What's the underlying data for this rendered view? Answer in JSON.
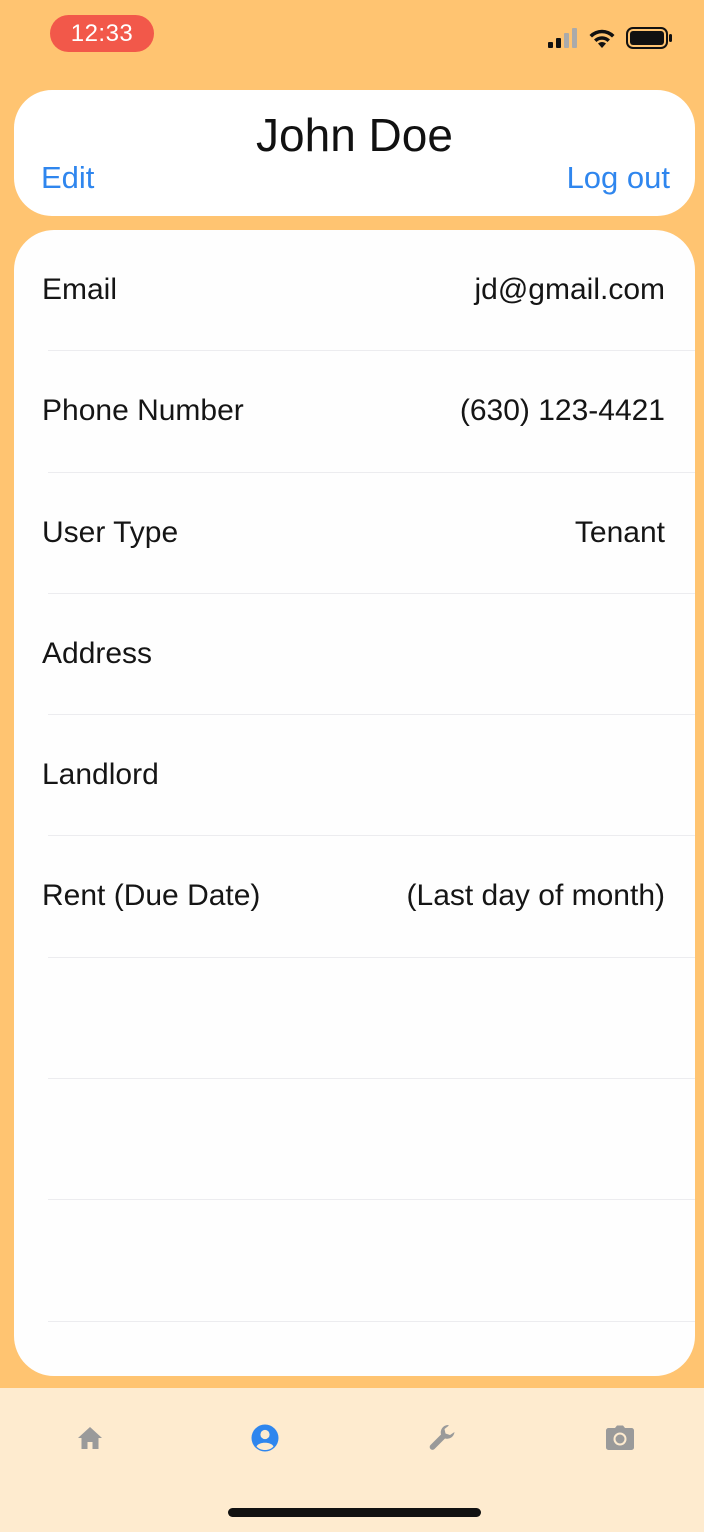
{
  "status_bar": {
    "time": "12:33",
    "time_pill_color": "#f2584a",
    "icons": [
      "cellular-signal-icon",
      "wifi-icon",
      "battery-icon"
    ]
  },
  "header": {
    "name": "John Doe",
    "edit_label": "Edit",
    "logout_label": "Log out",
    "link_color": "#2f86ee"
  },
  "profile": {
    "rows": [
      {
        "label": "Email",
        "value": "jd@gmail.com"
      },
      {
        "label": "Phone Number",
        "value": "(630) 123-4421"
      },
      {
        "label": "User Type",
        "value": "Tenant"
      },
      {
        "label": "Address",
        "value": ""
      },
      {
        "label": "Landlord",
        "value": ""
      },
      {
        "label": "Rent (Due Date)",
        "value": "(Last day of month)"
      },
      {
        "label": "",
        "value": ""
      },
      {
        "label": "",
        "value": ""
      },
      {
        "label": "",
        "value": ""
      }
    ]
  },
  "tab_bar": {
    "tabs": [
      {
        "icon": "home-icon",
        "active": false
      },
      {
        "icon": "profile-icon",
        "active": true
      },
      {
        "icon": "wrench-icon",
        "active": false
      },
      {
        "icon": "camera-icon",
        "active": false
      }
    ],
    "active_color": "#2f86ee",
    "inactive_color": "#9a9a9a"
  },
  "colors": {
    "background": "#ffc471",
    "tab_bar_background": "#feebcf"
  }
}
